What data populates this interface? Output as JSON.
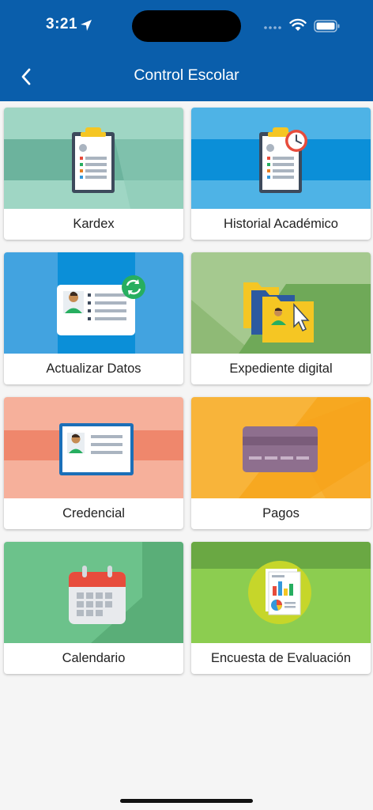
{
  "status_bar": {
    "time": "3:21"
  },
  "header": {
    "title": "Control Escolar"
  },
  "tiles": [
    {
      "label": "Kardex",
      "icon": "clipboard-icon",
      "bg": "#9fd6c4"
    },
    {
      "label": "Historial Académico",
      "icon": "clipboard-clock-icon",
      "bg": "#4eb3e6"
    },
    {
      "label": "Actualizar Datos",
      "icon": "id-card-refresh-icon",
      "bg": "#42a3e0"
    },
    {
      "label": "Expediente digital",
      "icon": "folders-icon",
      "bg": "#a5c98f"
    },
    {
      "label": "Credencial",
      "icon": "id-badge-icon",
      "bg": "#f6b09b"
    },
    {
      "label": "Pagos",
      "icon": "credit-card-icon",
      "bg": "#f8b43a"
    },
    {
      "label": "Calendario",
      "icon": "calendar-icon",
      "bg": "#6cc28b"
    },
    {
      "label": "Encuesta de Evaluación",
      "icon": "survey-report-icon",
      "bg": "#8ccd50"
    }
  ]
}
